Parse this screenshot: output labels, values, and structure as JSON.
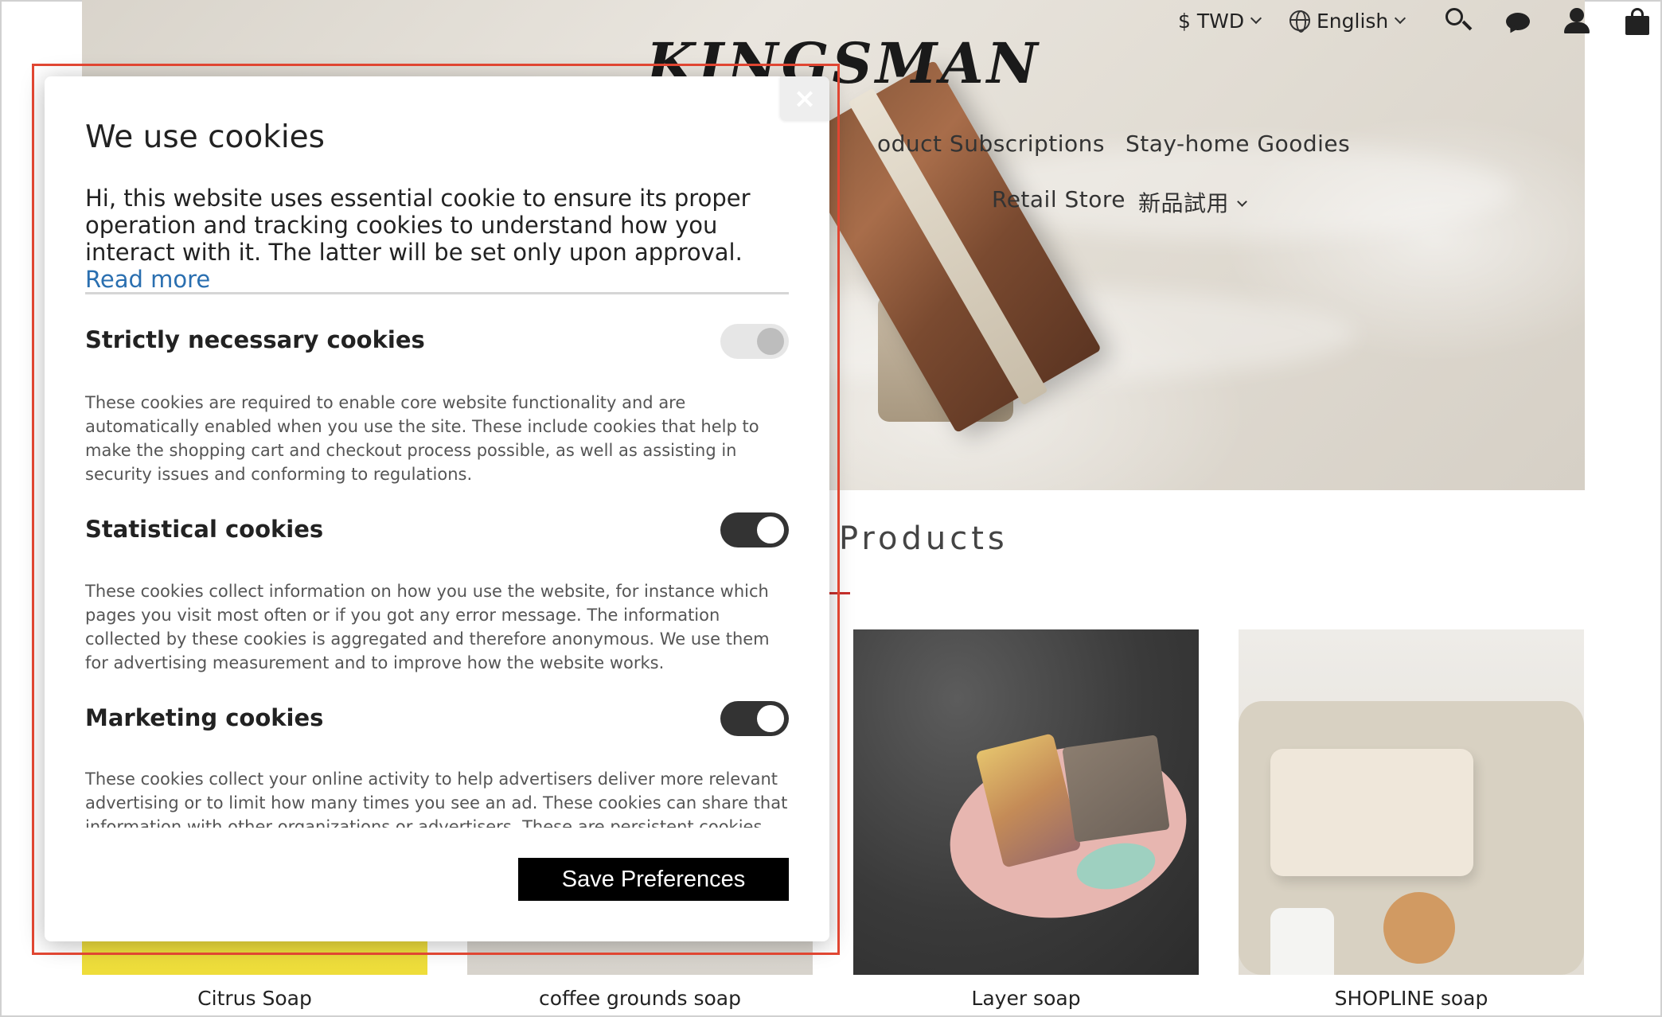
{
  "header": {
    "brand": "KINGSMAN",
    "currency": "$ TWD",
    "language": "English",
    "icons": [
      "search-icon",
      "chat-icon",
      "user-icon",
      "cart-icon"
    ]
  },
  "nav": {
    "row1": [
      "oduct Subscriptions",
      "Stay-home Goodies"
    ],
    "row2": [
      "Retail Store",
      "新品試用"
    ]
  },
  "section": {
    "title": "Products"
  },
  "products": [
    {
      "name": "Citrus Soap"
    },
    {
      "name": "coffee grounds soap"
    },
    {
      "name": "Layer soap"
    },
    {
      "name": "SHOPLINE soap"
    }
  ],
  "cookie_modal": {
    "close_glyph": "×",
    "title": "We use cookies",
    "intro": "Hi, this website uses essential cookie to ensure its proper operation and tracking cookies to understand how you interact with it. The latter will be set only upon approval.",
    "read_more": "Read more",
    "sections": [
      {
        "heading": "Strictly necessary cookies",
        "description": "These cookies are required to enable core website functionality and are automatically enabled when you use the site. These include cookies that help to make the shopping cart and checkout process possible, as well as assisting in security issues and conforming to regulations.",
        "enabled": true,
        "locked": true
      },
      {
        "heading": "Statistical cookies",
        "description": "These cookies collect information on how you use the website, for instance which pages you visit most often or if you got any error message. The information collected by these cookies is aggregated and therefore anonymous. We use them for advertising measurement and to improve how the website works.",
        "enabled": true,
        "locked": false
      },
      {
        "heading": "Marketing cookies",
        "description": "These cookies collect your online activity to help advertisers deliver more relevant advertising or to limit how many times you see an ad. These cookies can share that information with other organizations or advertisers. These are persistent cookies and",
        "enabled": true,
        "locked": false
      }
    ],
    "save_label": "Save Preferences"
  },
  "colors": {
    "highlight": "#e04632",
    "link": "#2a6fb0",
    "toggle_on": "#333333",
    "toggle_disabled": "#e6e6e6"
  }
}
